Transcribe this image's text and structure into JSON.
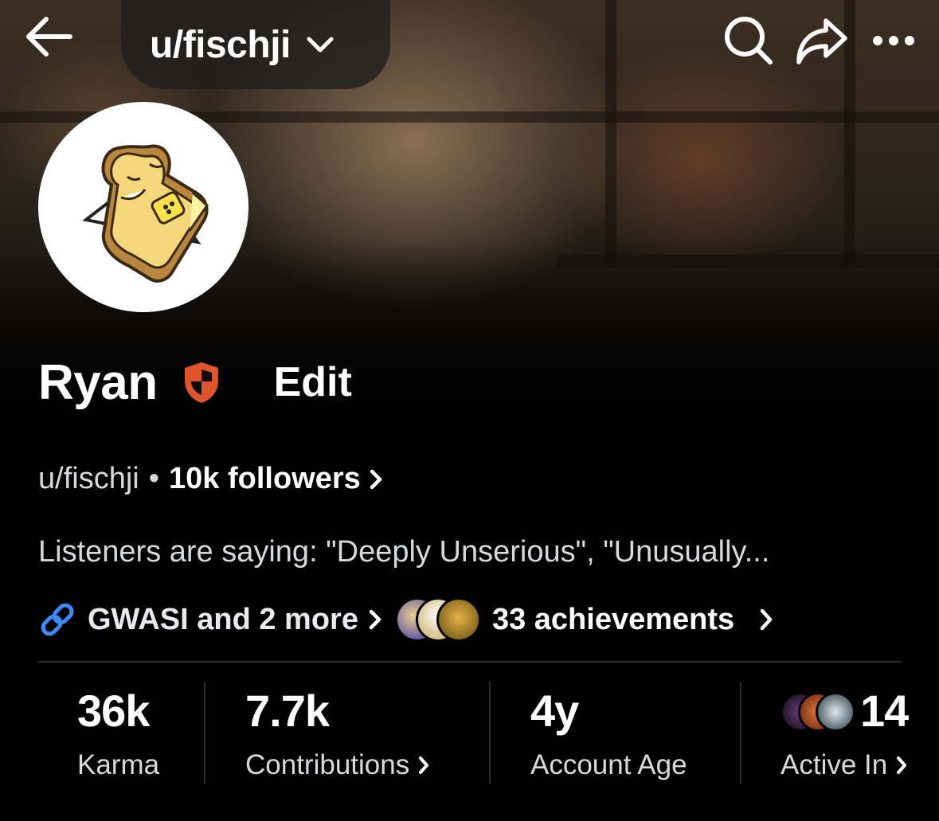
{
  "header": {
    "title": "u/fischji"
  },
  "profile": {
    "display_name": "Ryan",
    "edit_label": "Edit",
    "username": "u/fischji",
    "followers": "10k followers",
    "bio": "Listeners are saying: \"Deeply Unserious\", \"Unusually...",
    "links_label": "GWASI and 2 more",
    "achievements": "33 achievements"
  },
  "stats": {
    "karma_value": "36k",
    "karma_label": "Karma",
    "contributions_value": "7.7k",
    "contributions_label": "Contributions",
    "age_value": "4y",
    "age_label": "Account Age",
    "active_value": "14",
    "active_label": "Active In"
  },
  "colors": {
    "background": "#000000",
    "mod_shield": "#e0542c",
    "link_blue": "#3d8bfd",
    "divider": "#2a2c2e"
  },
  "icons": [
    "back-arrow-icon",
    "chevron-down-icon",
    "search-icon",
    "share-icon",
    "more-icon",
    "mod-shield-icon",
    "link-icon",
    "chevron-right-icon"
  ]
}
